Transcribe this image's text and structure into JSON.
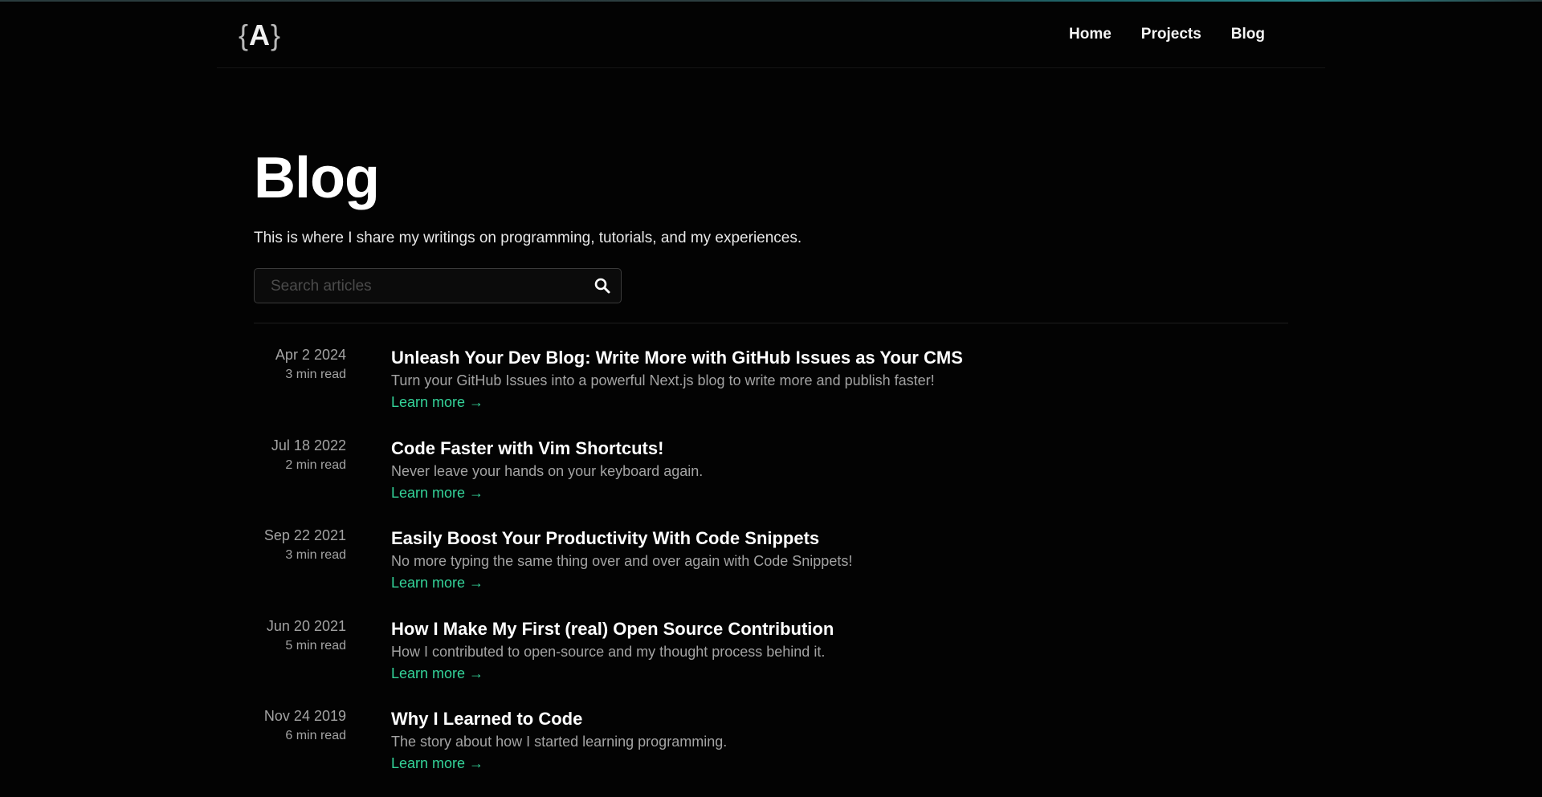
{
  "logo": {
    "open": "{",
    "letter": "A",
    "close": "}"
  },
  "nav": [
    {
      "label": "Home"
    },
    {
      "label": "Projects"
    },
    {
      "label": "Blog"
    }
  ],
  "page": {
    "title": "Blog",
    "subtitle": "This is where I share my writings on programming, tutorials, and my experiences."
  },
  "search": {
    "placeholder": "Search articles",
    "value": "",
    "icon": "search-icon"
  },
  "posts": [
    {
      "date": "Apr 2 2024",
      "read": "3 min read",
      "title": "Unleash Your Dev Blog: Write More with GitHub Issues as Your CMS",
      "desc": "Turn your GitHub Issues into a powerful Next.js blog to write more and publish faster!",
      "more": "Learn more →"
    },
    {
      "date": "Jul 18 2022",
      "read": "2 min read",
      "title": "Code Faster with Vim Shortcuts!",
      "desc": "Never leave your hands on your keyboard again.",
      "more": "Learn more →"
    },
    {
      "date": "Sep 22 2021",
      "read": "3 min read",
      "title": "Easily Boost Your Productivity With Code Snippets",
      "desc": "No more typing the same thing over and over again with Code Snippets!",
      "more": "Learn more →"
    },
    {
      "date": "Jun 20 2021",
      "read": "5 min read",
      "title": "How I Make My First (real) Open Source Contribution",
      "desc": "How I contributed to open-source and my thought process behind it.",
      "more": "Learn more →"
    },
    {
      "date": "Nov 24 2019",
      "read": "6 min read",
      "title": "Why I Learned to Code",
      "desc": "The story about how I started learning programming.",
      "more": "Learn more →"
    }
  ],
  "colors": {
    "background": "#030303",
    "accent": "#34d399",
    "muted_text": "#a3a3a3"
  }
}
